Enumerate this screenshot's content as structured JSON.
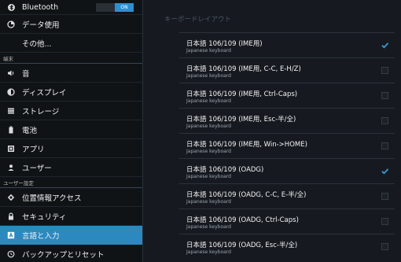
{
  "sidebar": {
    "bluetooth": {
      "label": "Bluetooth",
      "toggle": "ON"
    },
    "items_top": [
      {
        "label": "データ使用",
        "icon": "data-usage-icon"
      },
      {
        "label": "その他..."
      }
    ],
    "header_device": "端末",
    "items_device": [
      {
        "label": "音",
        "icon": "sound-icon"
      },
      {
        "label": "ディスプレイ",
        "icon": "display-icon"
      },
      {
        "label": "ストレージ",
        "icon": "storage-icon"
      },
      {
        "label": "電池",
        "icon": "battery-icon"
      },
      {
        "label": "アプリ",
        "icon": "apps-icon"
      },
      {
        "label": "ユーザー",
        "icon": "user-icon"
      }
    ],
    "header_user": "ユーザー設定",
    "items_user": [
      {
        "label": "位置情報アクセス",
        "icon": "location-icon"
      },
      {
        "label": "セキュリティ",
        "icon": "lock-icon"
      },
      {
        "label": "言語と入力",
        "icon": "language-icon",
        "selected": true
      },
      {
        "label": "バックアップとリセット",
        "icon": "backup-icon"
      }
    ]
  },
  "content": {
    "section_title": "キーボードレイアウト",
    "keyboards": [
      {
        "name": "日本語 106/109 (IME用)",
        "sub": "Japanese keyboard",
        "checked": true
      },
      {
        "name": "日本語 106/109 (IME用, C-C, E-H/Z)",
        "sub": "Japanese keyboard",
        "checked": false
      },
      {
        "name": "日本語 106/109 (IME用, Ctrl-Caps)",
        "sub": "Japanese keyboard",
        "checked": false
      },
      {
        "name": "日本語 106/109 (IME用, Esc-半/全)",
        "sub": "Japanese keyboard",
        "checked": false
      },
      {
        "name": "日本語 106/109 (IME用, Win->HOME)",
        "sub": "Japanese keyboard",
        "checked": false
      },
      {
        "name": "日本語 106/109 (OADG)",
        "sub": "Japanese keyboard",
        "checked": true
      },
      {
        "name": "日本語 106/109 (OADG, C-C, E-半/全)",
        "sub": "Japanese keyboard",
        "checked": false
      },
      {
        "name": "日本語 106/109 (OADG, Ctrl-Caps)",
        "sub": "Japanese keyboard",
        "checked": false
      },
      {
        "name": "日本語 106/109 (OADG, Esc-半/全)",
        "sub": "Japanese keyboard",
        "checked": false
      }
    ]
  },
  "colors": {
    "accent": "#2b89bf",
    "check": "#3a9bd9"
  }
}
